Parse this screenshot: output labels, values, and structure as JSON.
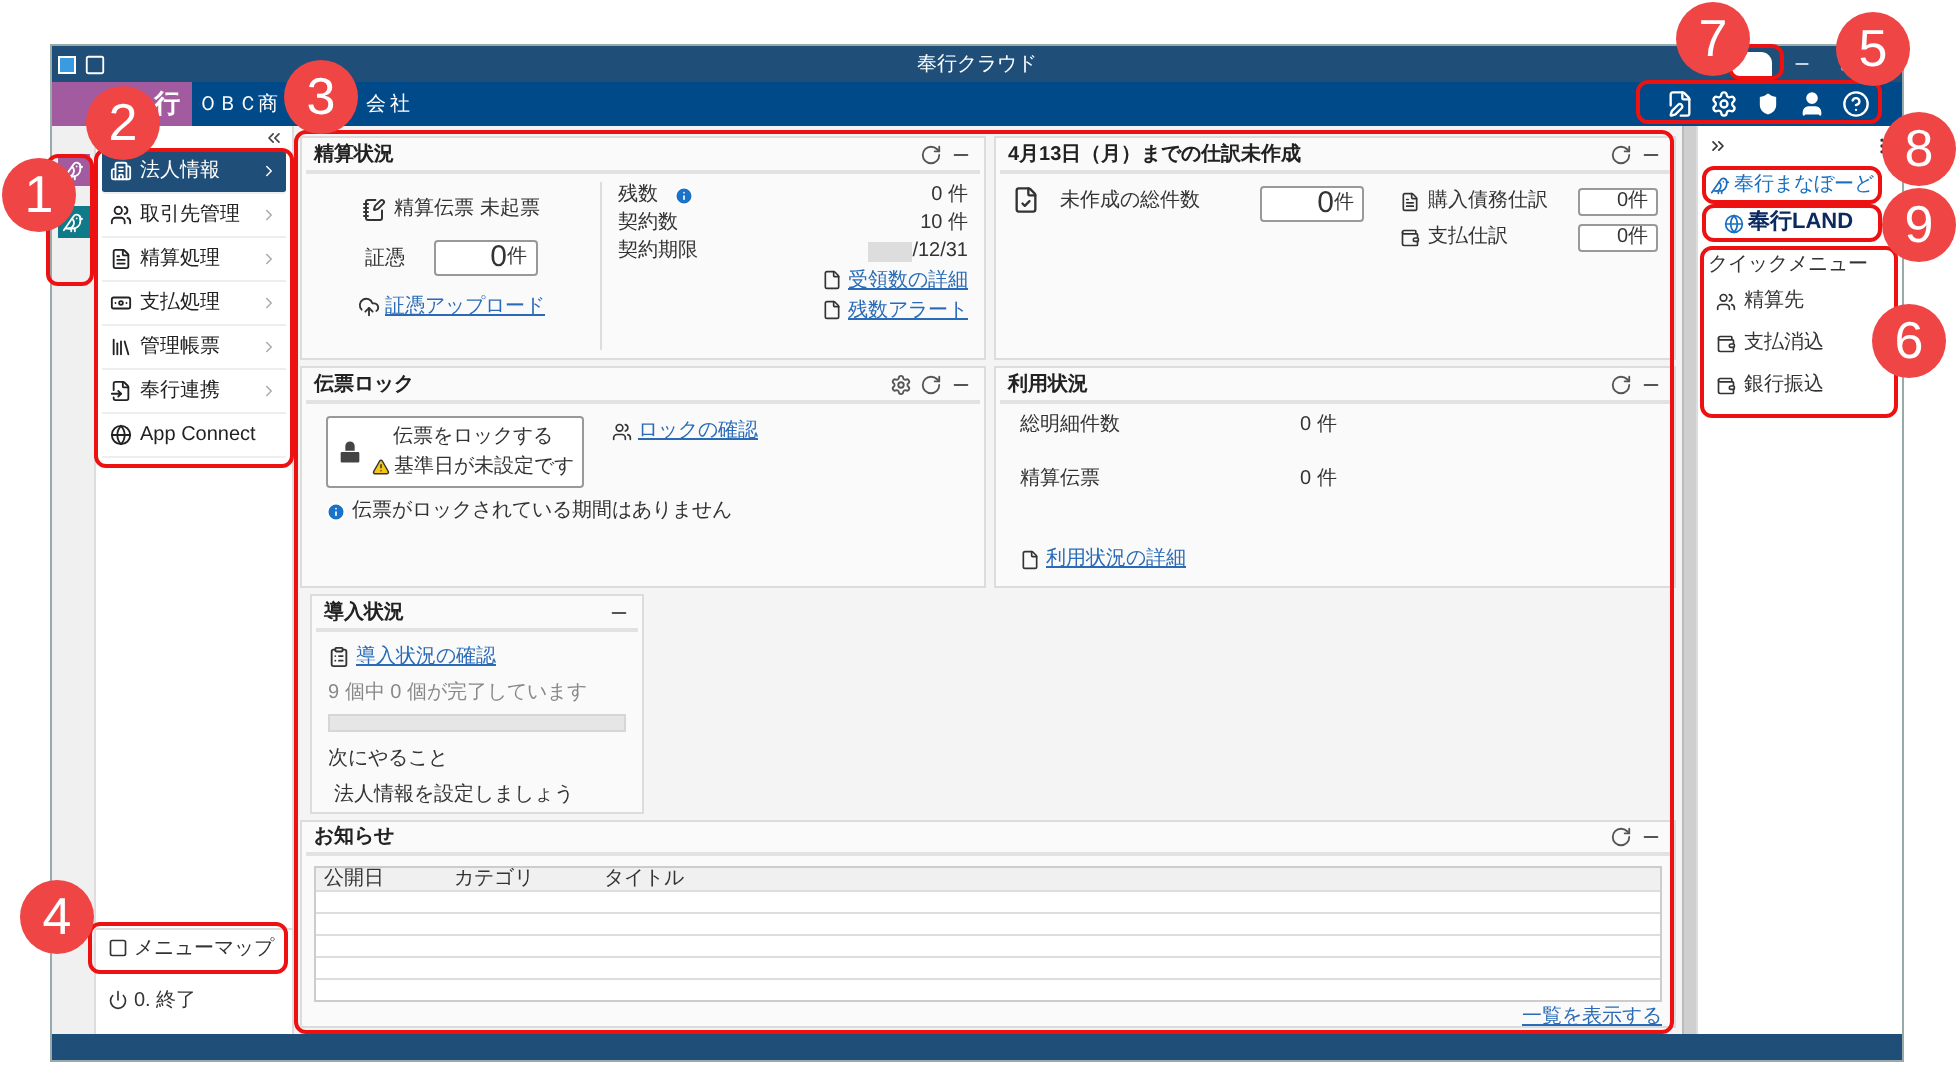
{
  "window": {
    "title": "奉行クラウド"
  },
  "header": {
    "logo_text": "行",
    "company_name": [
      "ＯＢＣ商",
      "会社"
    ]
  },
  "menu": {
    "items": [
      {
        "label": "法人情報",
        "selected": true,
        "has_submenu": true
      },
      {
        "label": "取引先管理",
        "selected": false,
        "has_submenu": true
      },
      {
        "label": "精算処理",
        "selected": false,
        "has_submenu": true
      },
      {
        "label": "支払処理",
        "selected": false,
        "has_submenu": true
      },
      {
        "label": "管理帳票",
        "selected": false,
        "has_submenu": true
      },
      {
        "label": "奉行連携",
        "selected": false,
        "has_submenu": true
      },
      {
        "label": "App Connect",
        "selected": false,
        "has_submenu": false
      }
    ],
    "footer": [
      {
        "label": "メニューマップ"
      },
      {
        "label": "0. 終了"
      }
    ]
  },
  "settlement_status": {
    "title": "精算状況",
    "status_label": "精算伝票 未起票",
    "receipt_label": "証憑",
    "receipt_count": {
      "value": "0",
      "unit": "件"
    },
    "upload_link": "証憑アップロード",
    "stats": [
      {
        "label": "残数",
        "value": "0 件",
        "has_info": true
      },
      {
        "label": "契約数",
        "value": "10 件",
        "has_info": false
      },
      {
        "label": "契約期限",
        "value": "/12/31",
        "has_info": false
      }
    ],
    "links": [
      "受領数の詳細",
      "残数アラート"
    ]
  },
  "unjournalized": {
    "title": "4月13日（月）までの仕訳未作成",
    "total_label": "未作成の総件数",
    "total_count": {
      "value": "0",
      "unit": "件"
    },
    "breakdown": [
      {
        "label": "購入債務仕訳",
        "value": "0",
        "unit": "件"
      },
      {
        "label": "支払仕訳",
        "value": "0",
        "unit": "件"
      }
    ]
  },
  "voucher_lock": {
    "title": "伝票ロック",
    "lock_button": "伝票をロックする",
    "warning": "基準日が未設定です",
    "check_link": "ロックの確認",
    "info": "伝票がロックされている期間はありません"
  },
  "usage_status": {
    "title": "利用状況",
    "rows": [
      {
        "label": "総明細件数",
        "value": "0 件"
      },
      {
        "label": "精算伝票",
        "value": "0 件"
      }
    ],
    "detail_link": "利用状況の詳細"
  },
  "setup_status": {
    "title": "導入状況",
    "check_link": "導入状況の確認",
    "progress_text": "9 個中 0 個が完了しています",
    "level": 0,
    "next_heading": "次にやること",
    "next_task": "法人情報を設定しましょう"
  },
  "notices": {
    "title": "お知らせ",
    "columns": [
      "公開日",
      "カテゴリ",
      "タイトル"
    ],
    "more_link": "一覧を表示する"
  },
  "right_panel": {
    "manabo_button": "奉行まなぼーど",
    "land_button": "奉行LAND",
    "quick_menu": {
      "title": "クイックメニュー",
      "items": [
        "精算先",
        "支払消込",
        "銀行振込"
      ]
    }
  },
  "callouts": [
    "1",
    "2",
    "3",
    "4",
    "5",
    "6",
    "7",
    "8",
    "9"
  ]
}
